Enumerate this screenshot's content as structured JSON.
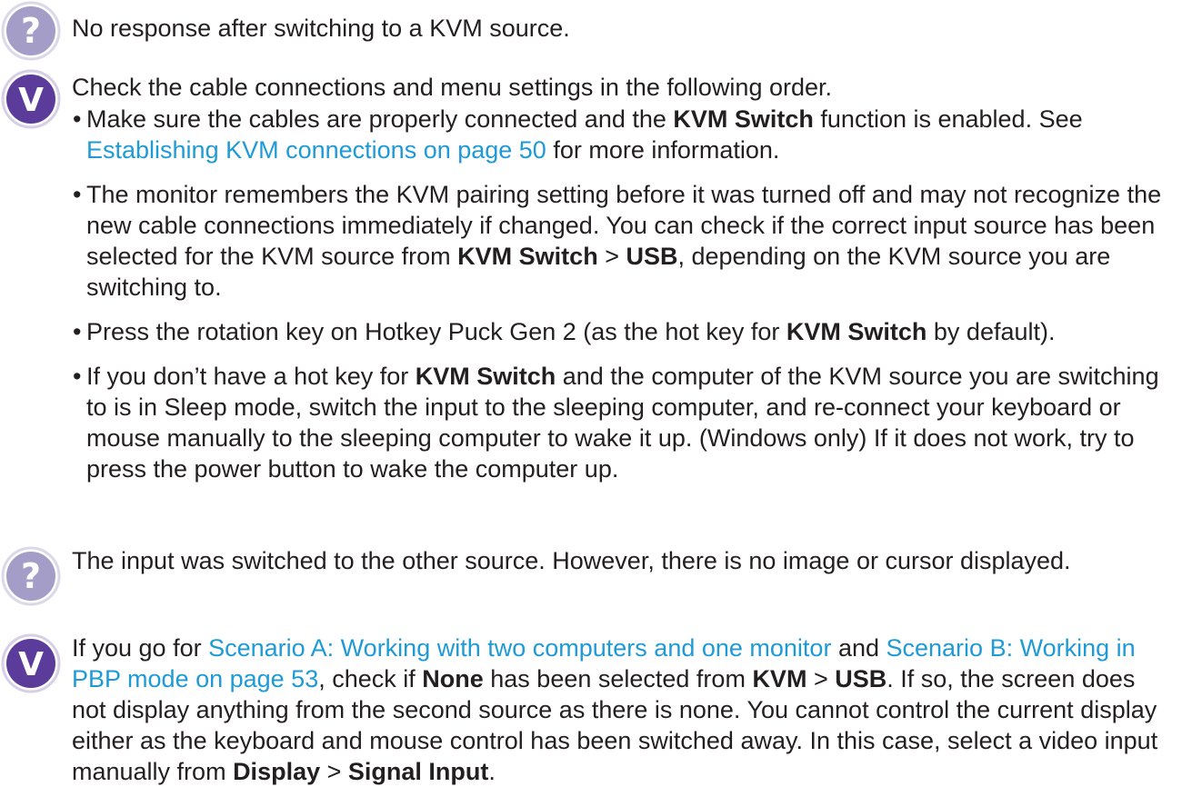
{
  "q1": {
    "icon": "question-icon",
    "text": "No response after switching to a KVM source."
  },
  "a1": {
    "icon": "check-icon",
    "intro": "Check the cable connections and menu settings in the following order.",
    "bullets": [
      {
        "t1": "Make sure the cables are properly connected and the ",
        "b1": "KVM Switch",
        "t2": " function is enabled. See ",
        "link": "Establishing KVM connections on page 50",
        "t3": " for more information."
      },
      {
        "t1": "The monitor remembers the KVM pairing setting before it was turned off and may not recognize the new cable connections immediately if changed. You can check if the correct input source has been selected for the KVM source from ",
        "b1": "KVM Switch",
        "sep": " > ",
        "b2": "USB",
        "t2": ", depending on the KVM source you are switching to."
      },
      {
        "t1": "Press the rotation key on Hotkey Puck Gen 2 (as the hot key for ",
        "b1": "KVM Switch",
        "t2": " by default)."
      },
      {
        "t1": "If you don’t have a hot key for ",
        "b1": "KVM Switch",
        "t2": " and the computer of the KVM source you are switching to is in Sleep mode, switch the input to the sleeping computer, and re-connect your keyboard or mouse manually to the sleeping computer to wake it up. (Windows only) If it does not work, try to press the power button to wake the computer up."
      }
    ]
  },
  "q2": {
    "icon": "question-icon",
    "text": "The input was switched to the other source. However, there is no image or cursor displayed."
  },
  "a2": {
    "icon": "check-icon",
    "t1": "If you go for ",
    "link1": "Scenario A: Working with two computers and one monitor",
    "t2": " and ",
    "link2": "Scenario B: Working in PBP mode on page 53",
    "t3": ", check if ",
    "b1": "None",
    "t4": " has been selected from ",
    "b2": "KVM",
    "sep1": " > ",
    "b3": "USB",
    "t5": ". If so, the screen does not display anything from the second source as there is none. You cannot control the current display either as the keyboard and mouse control has been switched away. In this case, select a video input manually from ",
    "b4": "Display",
    "sep2": " > ",
    "b5": "Signal Input",
    "t6": "."
  },
  "colors": {
    "question_icon": "#a39dc7",
    "check_icon": "#5b3c9b",
    "link": "#1e9ad6",
    "text": "#231f20"
  }
}
